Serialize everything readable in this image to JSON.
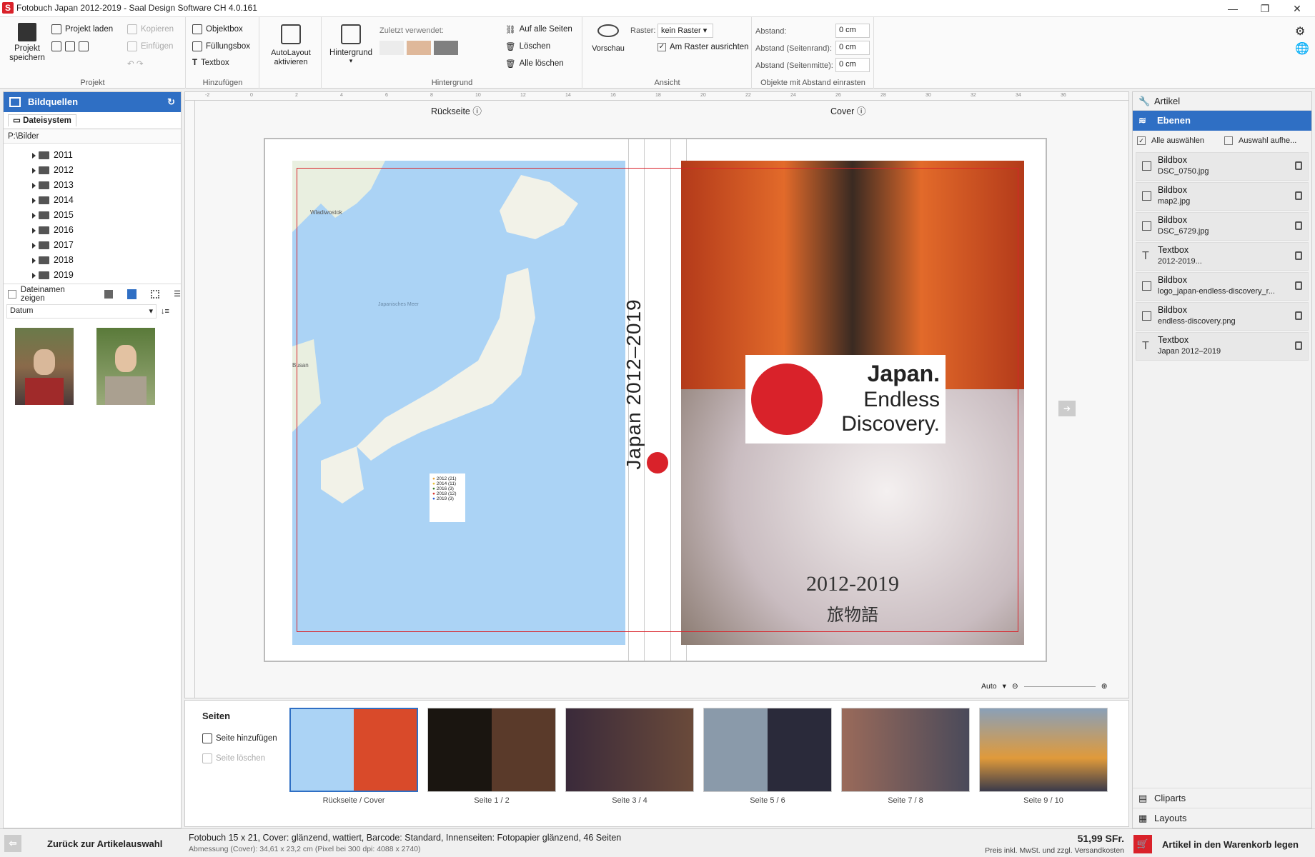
{
  "window": {
    "title": "Fotobuch Japan 2012-2019 - Saal Design Software CH 4.0.161",
    "logo": "S"
  },
  "ribbon": {
    "projekt": {
      "save": "Projekt speichern",
      "load": "Projekt laden",
      "copy": "Kopieren",
      "paste": "Einfügen",
      "group": "Projekt"
    },
    "hinzufuegen": {
      "objektbox": "Objektbox",
      "fuellungsbox": "Füllungsbox",
      "textbox": "Textbox",
      "group": "Hinzufügen"
    },
    "autolayout": "AutoLayout aktivieren",
    "hintergrund": {
      "button": "Hintergrund",
      "recent": "Zuletzt verwendet:",
      "all_pages": "Auf alle Seiten",
      "delete": "Löschen",
      "delete_all": "Alle löschen",
      "group": "Hintergrund",
      "swatches": [
        "#ececec",
        "#dfb89a",
        "#808080"
      ]
    },
    "ansicht": {
      "preview": "Vorschau",
      "raster_label": "Raster:",
      "raster_value": "kein Raster",
      "snap": "Am Raster ausrichten",
      "group": "Ansicht"
    },
    "abstand": {
      "label1": "Abstand:",
      "label2": "Abstand (Seitenrand):",
      "label3": "Abstand (Seitenmitte):",
      "v1": "0 cm",
      "v2": "0 cm",
      "v3": "0 cm",
      "group": "Objekte mit Abstand einrasten"
    }
  },
  "left": {
    "title": "Bildquellen",
    "tab": "Dateisystem",
    "path": "P:\\Bilder",
    "folders": [
      "2011",
      "2012",
      "2013",
      "2014",
      "2015",
      "2016",
      "2017",
      "2018",
      "2019"
    ],
    "show_names": "Dateinamen zeigen",
    "sort": "Datum"
  },
  "canvas": {
    "back_label": "Rückseite",
    "cover_label": "Cover",
    "spine_text": "Japan 2012–2019",
    "logo_line1": "Japan.",
    "logo_line2": "Endless",
    "logo_line3": "Discovery.",
    "years": "2012-2019",
    "kanji": "旅物語",
    "legend": [
      "2012 (21)",
      "2014 (11)",
      "2016 (3)",
      "2018 (12)",
      "2019 (3)"
    ],
    "legend_colors": [
      "#e8a23a",
      "#e8c23a",
      "#3a7d2a",
      "#d9322a",
      "#2a5fd9"
    ],
    "zoom": "Auto",
    "ruler_ticks": [
      "-2",
      "0",
      "2",
      "4",
      "6",
      "8",
      "10",
      "12",
      "14",
      "16",
      "18",
      "20",
      "22",
      "24",
      "26",
      "28",
      "30",
      "32",
      "34",
      "36"
    ]
  },
  "map": {
    "cities": [
      "Wladiwostok",
      "Busan",
      "Japanisches Meer"
    ]
  },
  "right": {
    "artikel": "Artikel",
    "ebenen": "Ebenen",
    "select_all": "Alle auswählen",
    "deselect": "Auswahl aufhe...",
    "layers": [
      {
        "type": "Bildbox",
        "name": "DSC_0750.jpg",
        "icon": "image-icon"
      },
      {
        "type": "Bildbox",
        "name": "map2.jpg",
        "icon": "image-icon"
      },
      {
        "type": "Bildbox",
        "name": "DSC_6729.jpg",
        "icon": "image-icon"
      },
      {
        "type": "Textbox",
        "name": "2012-2019...",
        "icon": "text-icon"
      },
      {
        "type": "Bildbox",
        "name": "logo_japan-endless-discovery_r...",
        "icon": "image-icon"
      },
      {
        "type": "Bildbox",
        "name": "endless-discovery.png",
        "icon": "image-icon"
      },
      {
        "type": "Textbox",
        "name": "Japan 2012–2019",
        "icon": "text-icon"
      }
    ],
    "cliparts": "Cliparts",
    "layouts": "Layouts"
  },
  "pages": {
    "title": "Seiten",
    "add": "Seite hinzufügen",
    "delete": "Seite löschen",
    "thumbs": [
      "Rückseite / Cover",
      "Seite 1 / 2",
      "Seite 3 / 4",
      "Seite 5 / 6",
      "Seite 7 / 8",
      "Seite 9 / 10"
    ]
  },
  "status": {
    "back": "Zurück zur Artikelauswahl",
    "line1": "Fotobuch 15 x 21, Cover: glänzend, wattiert, Barcode: Standard, Innenseiten: Fotopapier glänzend, 46 Seiten",
    "line2": "Abmessung (Cover): 34,61 x 23,2 cm (Pixel bei 300 dpi: 4088 x 2740)",
    "price": "51,99 SFr.",
    "price_note": "Preis inkl. MwSt. und zzgl. Versandkosten",
    "cart": "Artikel in den Warenkorb legen"
  }
}
